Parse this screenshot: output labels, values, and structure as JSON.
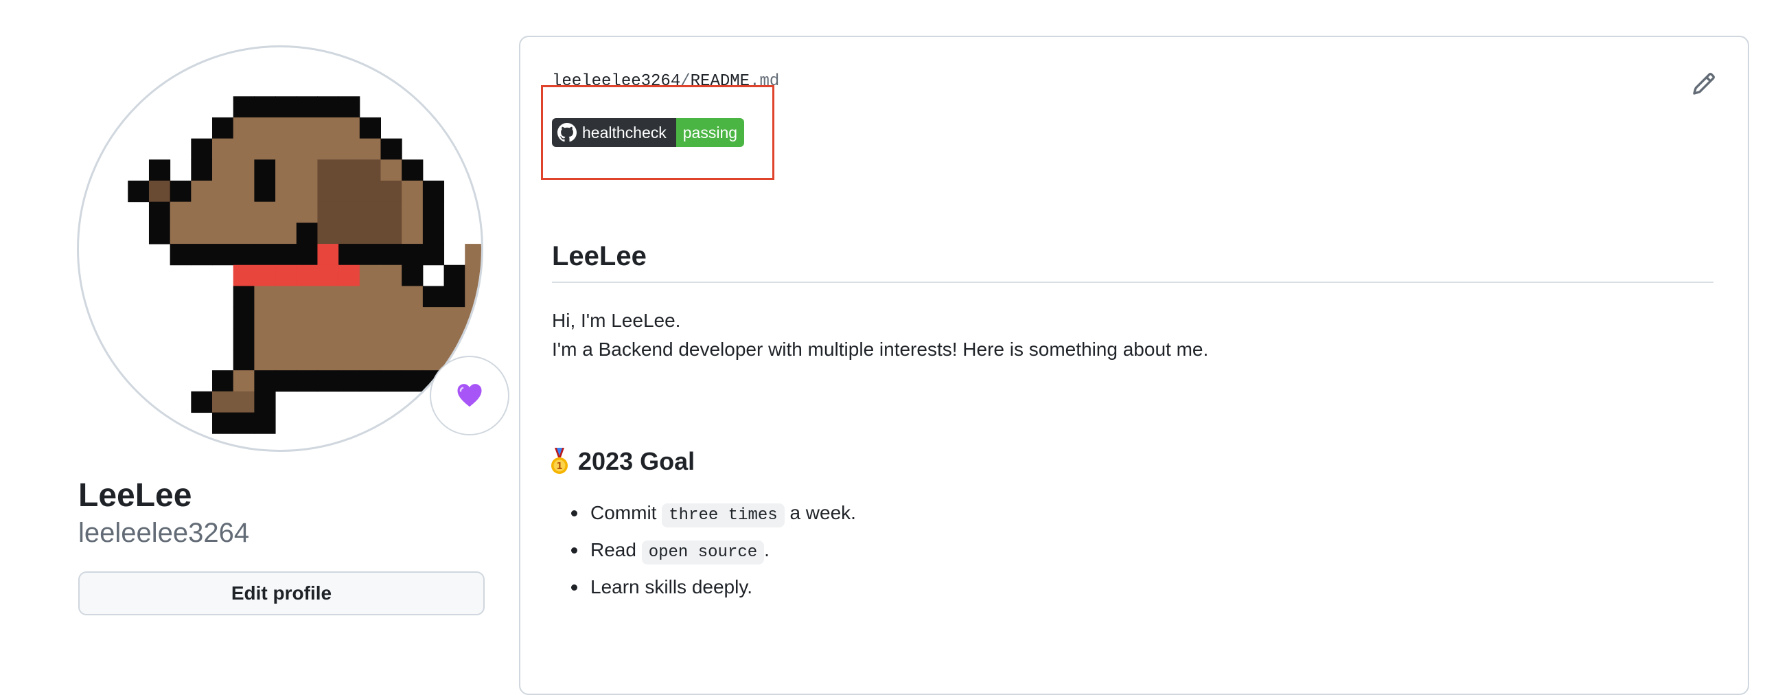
{
  "profile": {
    "name": "LeeLee",
    "login": "leeleelee3264",
    "edit_label": "Edit profile",
    "status_icon": "purple-heart-icon"
  },
  "readme": {
    "owner": "leeleelee3264",
    "separator": "/",
    "file_name": "README",
    "file_ext": ".md",
    "edit_icon": "pencil-icon",
    "badge": {
      "label": "healthcheck",
      "status": "passing",
      "label_color": "#2f3337",
      "status_color": "#4bb543"
    },
    "heading": "LeeLee",
    "intro_line1": "Hi, I'm LeeLee.",
    "intro_line2": "I'm a Backend developer with multiple interests! Here is something about me.",
    "goal_heading": "2023 Goal",
    "goals": [
      {
        "before": "Commit ",
        "code": "three times",
        "after": " a week."
      },
      {
        "before": "Read ",
        "code": "open source",
        "after": "."
      },
      {
        "before": "Learn skills deeply.",
        "code": "",
        "after": ""
      }
    ]
  },
  "colors": {
    "highlight": "#e0432b",
    "muted": "#636c76",
    "border": "#d0d7de"
  }
}
